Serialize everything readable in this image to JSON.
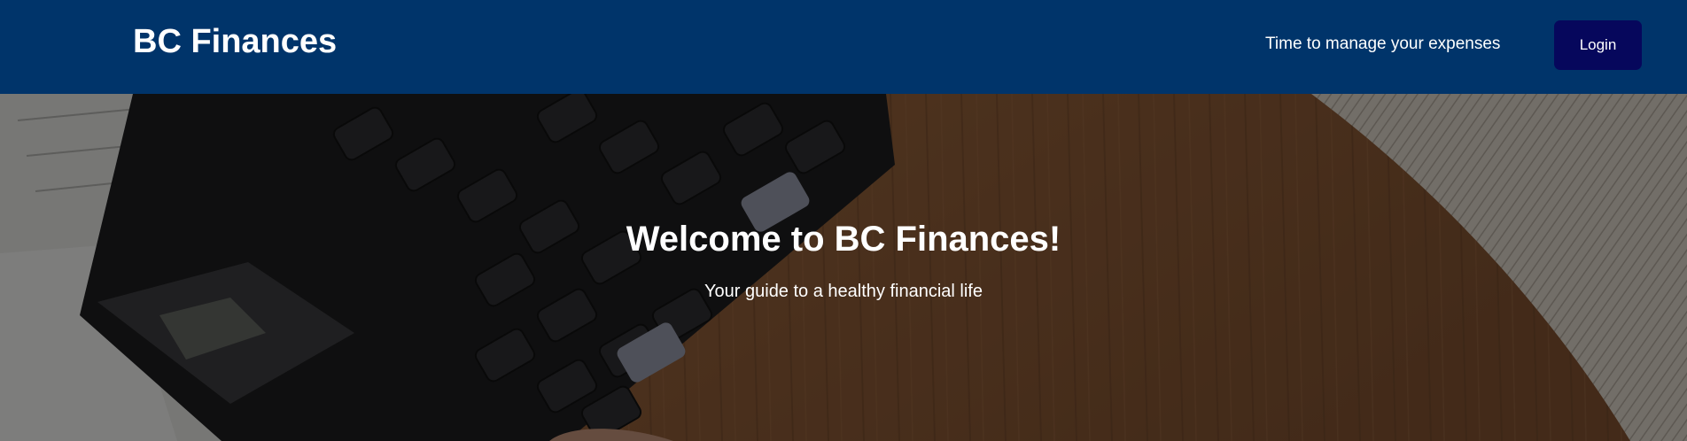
{
  "navbar": {
    "brand": "BC Finances",
    "tagline": "Time to manage your expenses",
    "login_label": "Login"
  },
  "hero": {
    "title": "Welcome to BC Finances!",
    "subtitle": "Your guide to a healthy financial life",
    "background_image": "calculator-on-desk-photo"
  },
  "colors": {
    "navbar_bg": "#00346a",
    "login_button_bg": "#06075c",
    "text": "#ffffff"
  }
}
